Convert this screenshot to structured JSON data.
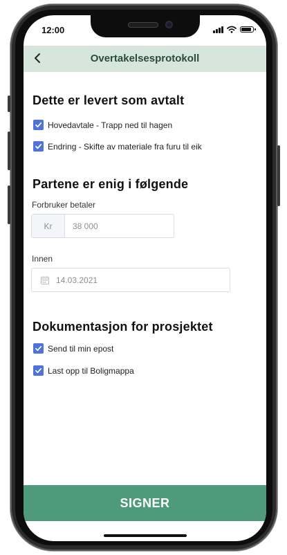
{
  "status_bar": {
    "time": "12:00"
  },
  "nav": {
    "back_icon": "chevron-left-icon",
    "title": "Overtakelsesprotokoll"
  },
  "section_delivered": {
    "heading": "Dette er levert som avtalt",
    "items": [
      {
        "label": "Hovedavtale - Trapp ned til hagen",
        "checked": true
      },
      {
        "label": "Endring - Skifte av materiale fra furu til eik",
        "checked": true
      }
    ]
  },
  "section_agreement": {
    "heading": "Partene er enig i følgende",
    "payment": {
      "label": "Forbruker betaler",
      "prefix": "Kr",
      "value": "38 000"
    },
    "deadline": {
      "label": "Innen",
      "icon": "calendar-icon",
      "value": "14.03.2021"
    }
  },
  "section_documentation": {
    "heading": "Dokumentasjon for prosjektet",
    "items": [
      {
        "label": "Send til min epost",
        "checked": true
      },
      {
        "label": "Last opp til Boligmappa",
        "checked": true
      }
    ]
  },
  "footer": {
    "sign_label": "SIGNER"
  },
  "colors": {
    "nav_background": "#d6e6dc",
    "checkbox": "#4f73d9",
    "sign_button": "#4e9a7b"
  }
}
